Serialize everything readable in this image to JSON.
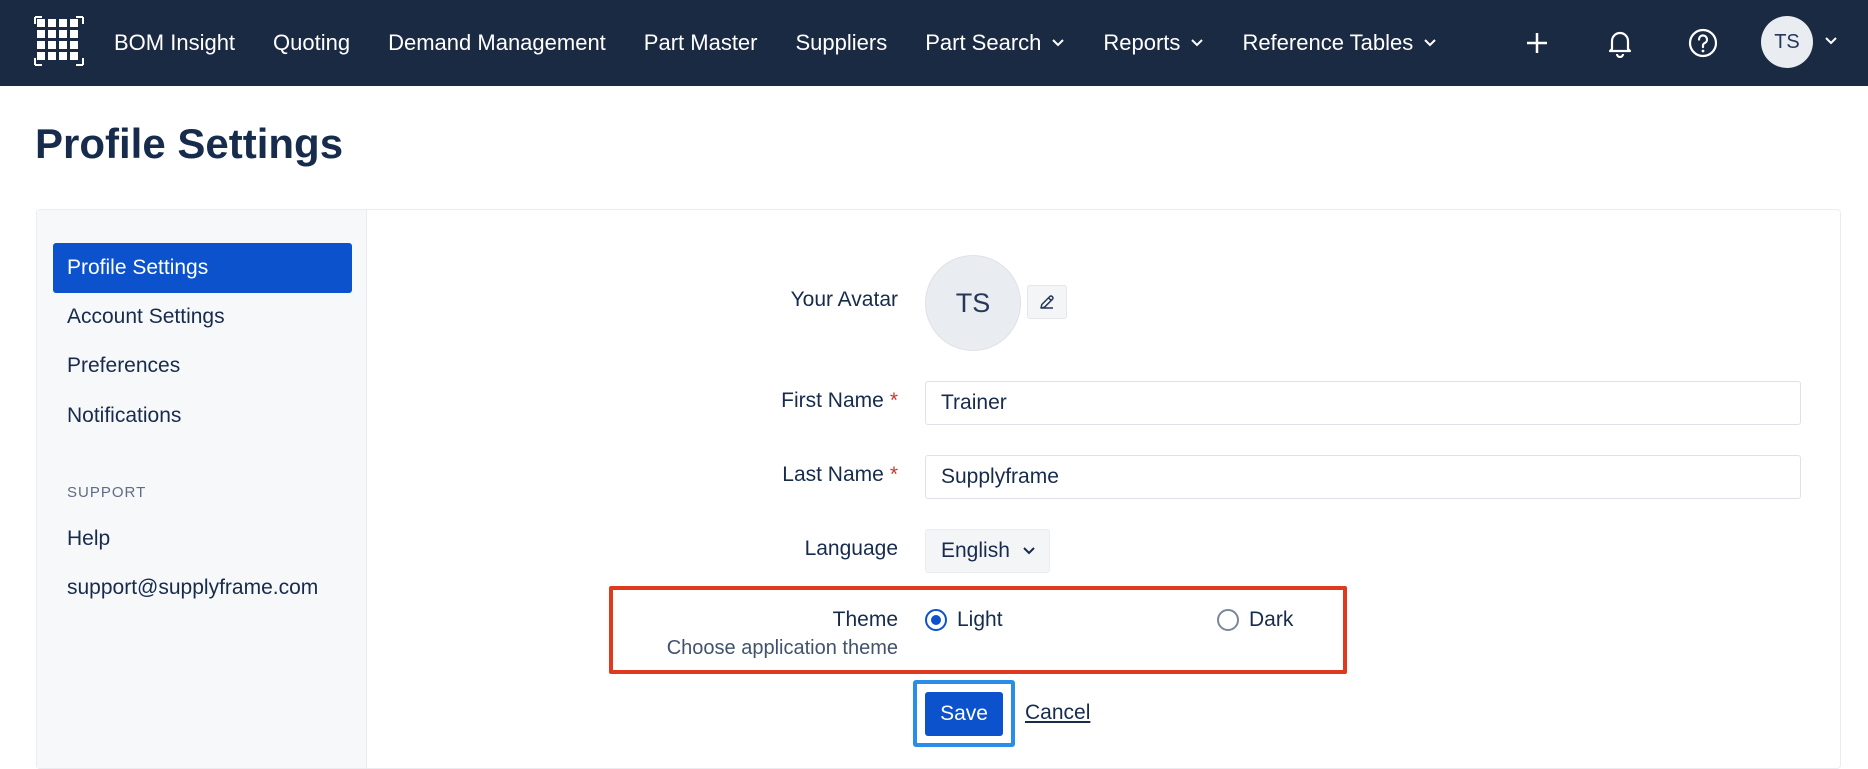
{
  "nav": {
    "logo_icon": "grid-logo-icon",
    "items": [
      {
        "label": "BOM Insight"
      },
      {
        "label": "Quoting"
      },
      {
        "label": "Demand Management"
      },
      {
        "label": "Part Master"
      },
      {
        "label": "Suppliers"
      },
      {
        "label": "Part Search",
        "dropdown": true
      },
      {
        "label": "Reports",
        "dropdown": true
      },
      {
        "label": "Reference Tables",
        "dropdown": true
      }
    ],
    "icons": [
      "plus-icon",
      "bell-icon",
      "help-icon"
    ],
    "avatar_initials": "TS"
  },
  "page": {
    "title": "Profile Settings"
  },
  "sidebar": {
    "items": [
      {
        "label": "Profile Settings",
        "active": true
      },
      {
        "label": "Account Settings"
      },
      {
        "label": "Preferences"
      },
      {
        "label": "Notifications"
      }
    ],
    "support_heading": "SUPPORT",
    "support_items": [
      {
        "label": "Help"
      },
      {
        "label": "support@supplyframe.com"
      }
    ]
  },
  "form": {
    "avatar_label": "Your Avatar",
    "avatar_initials": "TS",
    "first_name_label": "First Name",
    "first_name_value": "Trainer",
    "last_name_label": "Last Name",
    "last_name_value": "Supplyframe",
    "required_marker": "*",
    "language_label": "Language",
    "language_value": "English",
    "theme_label": "Theme",
    "theme_sublabel": "Choose application theme",
    "theme_options": [
      {
        "label": "Light",
        "selected": true
      },
      {
        "label": "Dark",
        "selected": false
      }
    ],
    "save_label": "Save",
    "cancel_label": "Cancel"
  },
  "colors": {
    "nav_bg": "#1b2a43",
    "primary": "#0b52cc",
    "highlight_red": "#e03a1e",
    "highlight_blue": "#2a8de8"
  }
}
